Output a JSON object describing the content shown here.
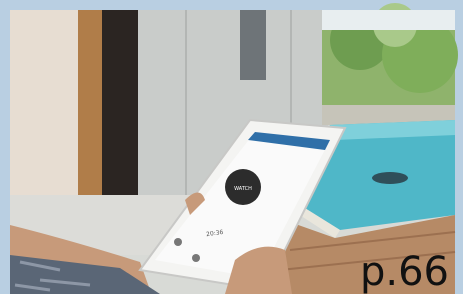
{
  "photo": {
    "subject": "person-holding-tablet-pool-app"
  },
  "tablet": {
    "center_button_label": "WATCH",
    "status_text": "20:36"
  },
  "caption": {
    "text": "p.66"
  },
  "colors": {
    "sky_blue_border": "#b9cfe2",
    "pool_water": "#4fb7c8",
    "wood_deck": "#b68a66",
    "wall_grey": "#cfd2cf",
    "tablet_dark_button": "#2c2c2c",
    "caption_text": "#111111"
  }
}
